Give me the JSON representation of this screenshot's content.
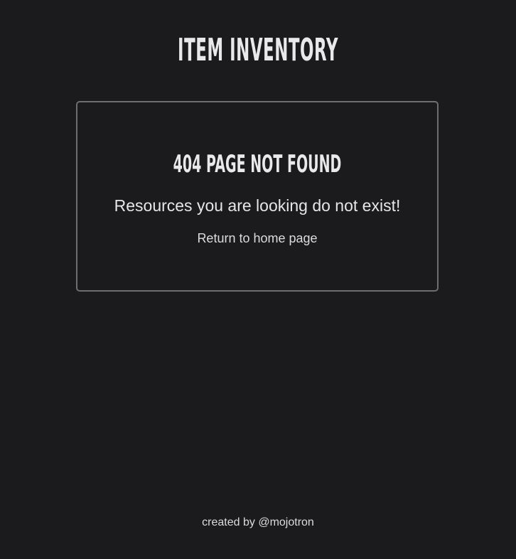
{
  "header": {
    "title": "ITEM INVENTORY"
  },
  "error_panel": {
    "heading": "404 PAGE NOT FOUND",
    "message": "Resources you are looking do not exist!",
    "home_link_label": "Return to home page"
  },
  "footer": {
    "credit": "created by @mojotron"
  },
  "colors": {
    "background": "#1b1b1d",
    "text": "#e6e6e8",
    "panel_border": "#6e6e71"
  }
}
